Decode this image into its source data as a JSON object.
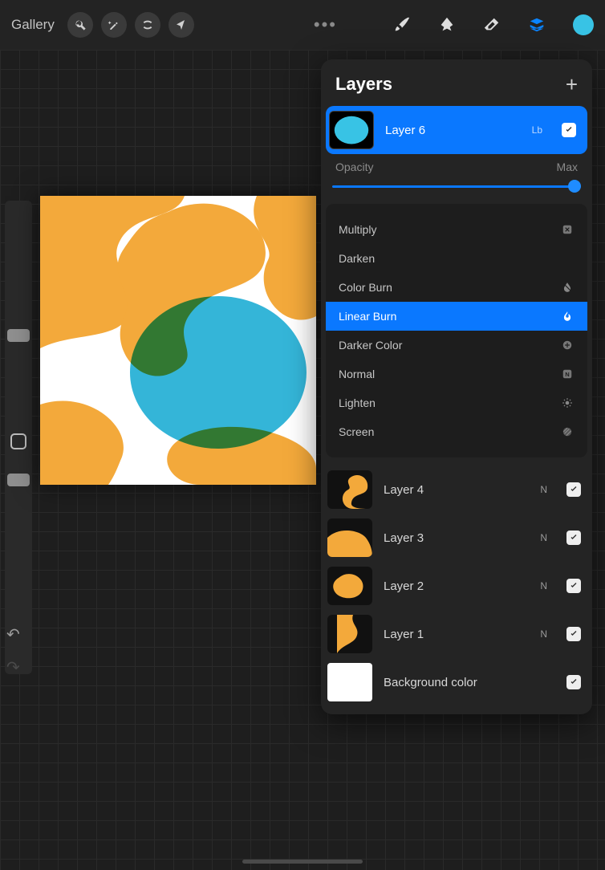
{
  "toolbar": {
    "gallery": "Gallery"
  },
  "panel": {
    "title": "Layers",
    "opacity_label": "Opacity",
    "opacity_max": "Max",
    "selected_layer": {
      "name": "Layer 6",
      "mode": "Lb"
    },
    "blend_modes": [
      {
        "label": "Multiply",
        "ico": "x"
      },
      {
        "label": "Darken",
        "ico": "moon"
      },
      {
        "label": "Color Burn",
        "ico": "drop"
      },
      {
        "label": "Linear Burn",
        "ico": "flame",
        "selected": true
      },
      {
        "label": "Darker Color",
        "ico": "plus"
      },
      {
        "label": "Normal",
        "ico": "N"
      },
      {
        "label": "Lighten",
        "ico": "sun"
      },
      {
        "label": "Screen",
        "ico": "hatch"
      }
    ],
    "layers": [
      {
        "name": "Layer 4",
        "mode": "N"
      },
      {
        "name": "Layer 3",
        "mode": "N"
      },
      {
        "name": "Layer 2",
        "mode": "N"
      },
      {
        "name": "Layer 1",
        "mode": "N"
      }
    ],
    "background_label": "Background color"
  },
  "colors": {
    "accent": "#0a78ff",
    "swatch": "#38c3e5",
    "orange": "#f3a93b",
    "green": "#3a9a4e",
    "cyan": "#34b5d8"
  }
}
